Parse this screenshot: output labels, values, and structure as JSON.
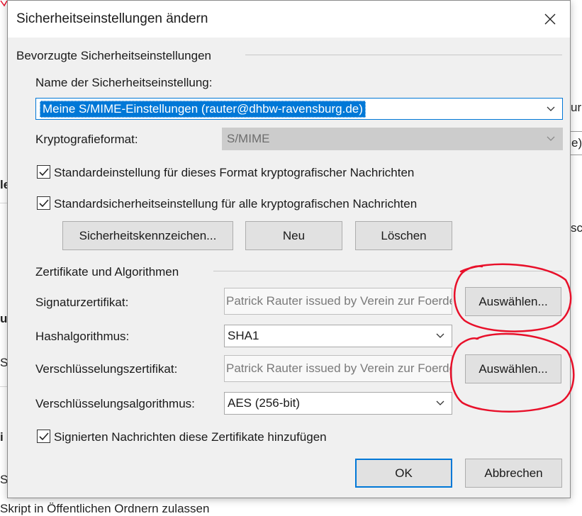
{
  "background": {
    "frag_top_right_1": "ur",
    "frag_top_right_2": "e)",
    "frag_left_1": "le",
    "frag_right_3": "sc",
    "frag_left_2": "ur",
    "frag_left_3": "St",
    "frag_left_4": "i",
    "frag_left_5": "Sk",
    "frag_bottom": "Skript in Öffentlichen Ordnern zulassen"
  },
  "dialog": {
    "title": "Sicherheitseinstellungen ändern",
    "preferred_group_label": "Bevorzugte Sicherheitseinstellungen",
    "name_label": "Name der Sicherheitseinstellung:",
    "name_value": "Meine S/MIME-Einstellungen (rauter@dhbw-ravensburg.de)",
    "crypto_format_label": "Kryptografieformat:",
    "crypto_format_value": "S/MIME",
    "checkbox_default_format": {
      "label": "Standardeinstellung für dieses Format kryptografischer Nachrichten",
      "checked": true
    },
    "checkbox_default_all": {
      "label": "Standardsicherheitseinstellung für alle kryptografischen Nachrichten",
      "checked": true
    },
    "security_labels_button": "Sicherheitskennzeichen...",
    "new_button": "Neu",
    "delete_button": "Löschen",
    "certs_group_label": "Zertifikate und Algorithmen",
    "signing_cert_label": "Signaturzertifikat:",
    "signing_cert_value": "Patrick Rauter issued by Verein zur Foerderung eines Deutschen Forschungsnetzes e. V.",
    "choose_button_1": "Auswählen...",
    "hash_label": "Hashalgorithmus:",
    "hash_value": "SHA1",
    "encryption_cert_label": "Verschlüsselungszertifikat:",
    "encryption_cert_value": "Patrick Rauter issued by Verein zur Foerderung eines Deutschen Forschungsnetzes e. V.",
    "choose_button_2": "Auswählen...",
    "encryption_alg_label": "Verschlüsselungsalgorithmus:",
    "encryption_alg_value": "AES (256-bit)",
    "checkbox_add_certs": {
      "label": "Signierten Nachrichten diese Zertifikate hinzufügen",
      "checked": true
    },
    "ok_button": "OK",
    "cancel_button": "Abbrechen"
  },
  "colors": {
    "accent": "#0078d7",
    "annotation": "#e8102a"
  },
  "annotations": [
    "red-circle-around-choose-button-1",
    "red-circle-around-choose-button-2"
  ]
}
